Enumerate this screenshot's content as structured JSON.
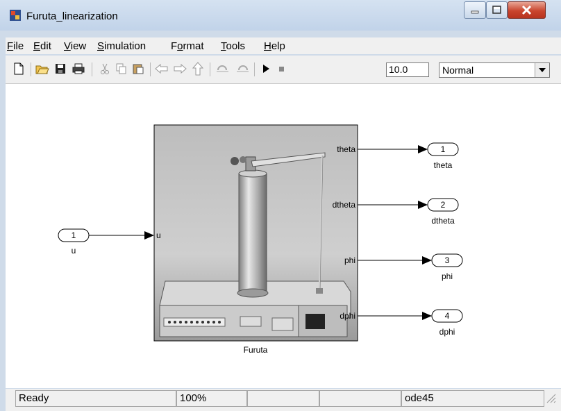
{
  "window": {
    "title": "Furuta_linearization"
  },
  "menu": {
    "items": [
      "File",
      "Edit",
      "View",
      "Simulation",
      "Format",
      "Tools",
      "Help"
    ],
    "underline": [
      "F",
      "E",
      "V",
      "S",
      "o",
      "T",
      "H"
    ]
  },
  "toolbar": {
    "stop_time": "10.0",
    "sim_mode": "Normal"
  },
  "diagram": {
    "subsystem_name": "Furuta",
    "inport": {
      "number": "1",
      "name": "u",
      "port_label": "u"
    },
    "outports": [
      {
        "number": "1",
        "name": "theta",
        "port_label": "theta"
      },
      {
        "number": "2",
        "name": "dtheta",
        "port_label": "dtheta"
      },
      {
        "number": "3",
        "name": "phi",
        "port_label": "phi"
      },
      {
        "number": "4",
        "name": "dphi",
        "port_label": "dphi"
      }
    ]
  },
  "status": {
    "state": "Ready",
    "zoom": "100%",
    "solver": "ode45"
  },
  "colors": {
    "titlebar": "#c9d9ec",
    "close": "#c9452e",
    "canvas": "#ffffff"
  }
}
